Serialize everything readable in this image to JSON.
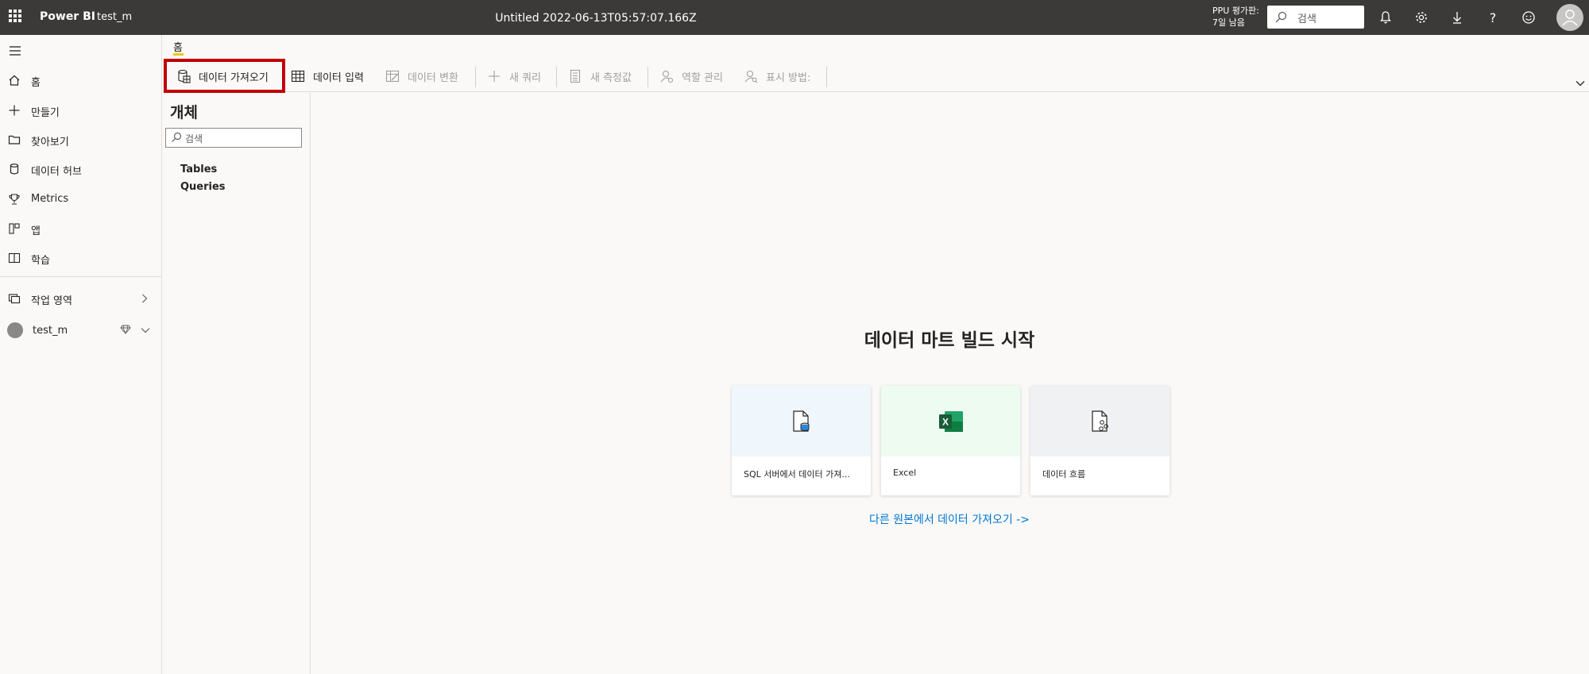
{
  "topbar": {
    "brand": "Power BI",
    "workspace": "test_m",
    "doc_title": "Untitled 2022-06-13T05:57:07.166Z",
    "trial_line1": "PPU 평가판:",
    "trial_line2": "7일 남음",
    "search_placeholder": "검색"
  },
  "nav": {
    "items": [
      {
        "label": "홈",
        "icon": "home-icon"
      },
      {
        "label": "만들기",
        "icon": "plus-icon"
      },
      {
        "label": "찾아보기",
        "icon": "folder-icon"
      },
      {
        "label": "데이터 허브",
        "icon": "database-icon"
      },
      {
        "label": "Metrics",
        "icon": "trophy-icon"
      },
      {
        "label": "앱",
        "icon": "apps-icon"
      },
      {
        "label": "학습",
        "icon": "book-icon"
      }
    ],
    "workspaces_label": "작업 영역",
    "current_ws": "test_m"
  },
  "ribbon": {
    "tab": "홈",
    "get_data": "데이터 가져오기",
    "enter_data": "데이터 입력",
    "transform": "데이터 변환",
    "new_query": "새 쿼리",
    "new_measure": "새 측정값",
    "manage_roles": "역할 관리",
    "view_as": "표시 방법:"
  },
  "objects": {
    "title": "개체",
    "search_placeholder": "검색",
    "items": [
      "Tables",
      "Queries"
    ]
  },
  "main": {
    "title": "데이터 마트 빌드 시작",
    "cards": [
      {
        "label": "SQL 서버에서 데이터 가져...",
        "band": "#eff6fc"
      },
      {
        "label": "Excel",
        "band": "#eefbf1"
      },
      {
        "label": "데이터 흐름",
        "band": "#f0f1f3"
      }
    ],
    "other_link": "다른 원본에서 데이터 가져오기 ->"
  },
  "colors": {
    "topbar": "#3b3a39",
    "highlight": "#c00000",
    "accent": "#f2c811",
    "link": "#0078d4"
  }
}
